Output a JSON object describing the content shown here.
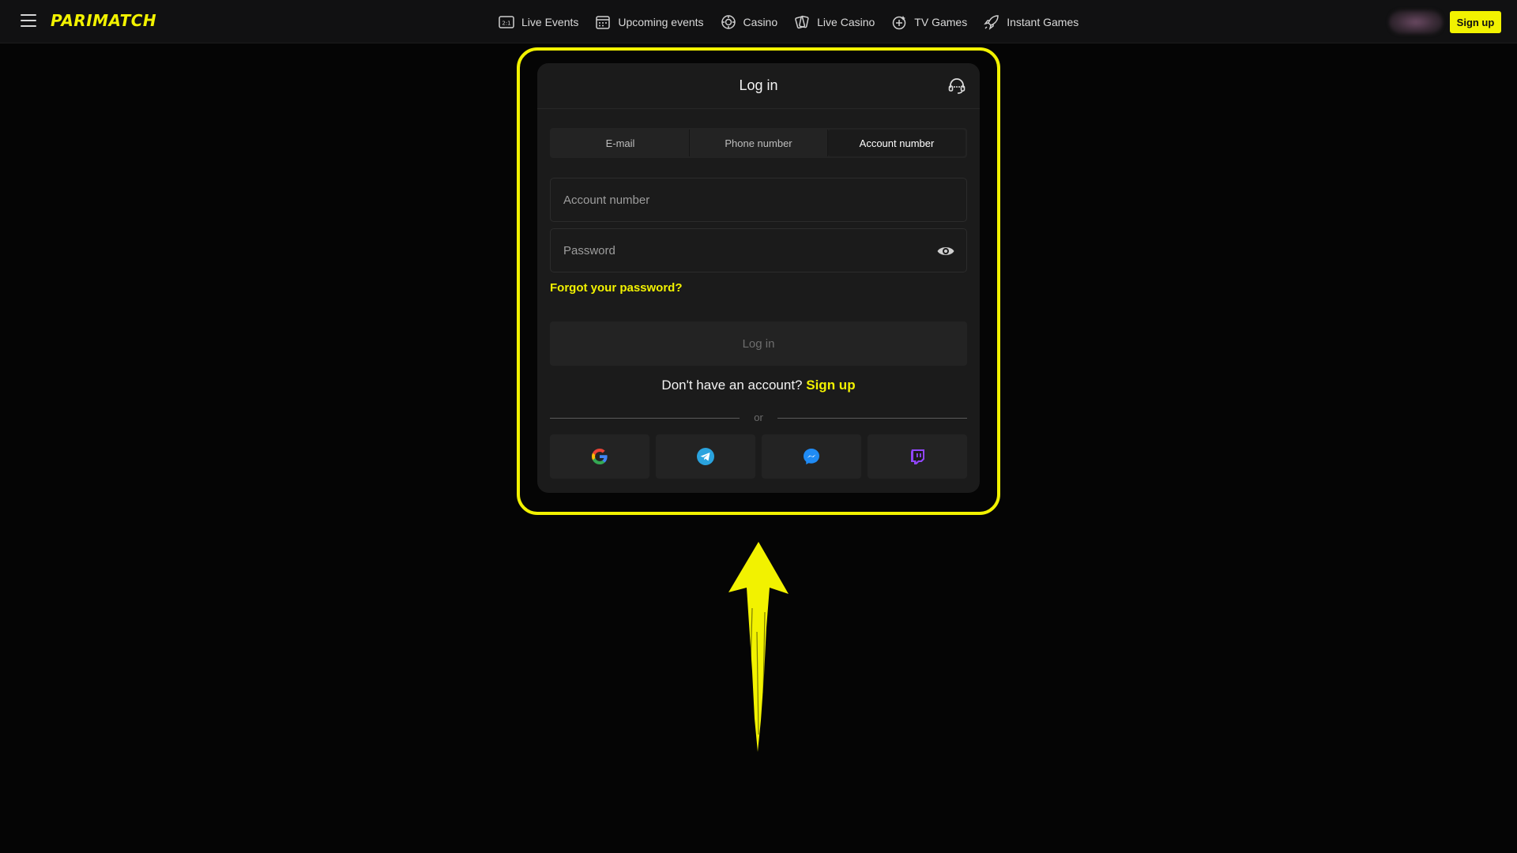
{
  "header": {
    "logo": "PARIMATCH",
    "nav": [
      {
        "label": "Live Events",
        "icon": "live-events-icon"
      },
      {
        "label": "Upcoming events",
        "icon": "calendar-icon"
      },
      {
        "label": "Casino",
        "icon": "casino-chip-icon"
      },
      {
        "label": "Live Casino",
        "icon": "cards-icon"
      },
      {
        "label": "TV Games",
        "icon": "tv-games-icon"
      },
      {
        "label": "Instant Games",
        "icon": "rocket-icon"
      }
    ],
    "signup_label": "Sign up"
  },
  "modal": {
    "title": "Log in",
    "tabs": [
      {
        "label": "E-mail",
        "active": false
      },
      {
        "label": "Phone number",
        "active": false
      },
      {
        "label": "Account number",
        "active": true
      }
    ],
    "account_placeholder": "Account number",
    "password_placeholder": "Password",
    "forgot_label": "Forgot your password?",
    "login_label": "Log in",
    "no_account_text": "Don't have an account?",
    "signup_link": "Sign up",
    "or_label": "or",
    "socials": [
      "google-icon",
      "telegram-icon",
      "messenger-icon",
      "twitch-icon"
    ]
  },
  "colors": {
    "accent": "#f2f200",
    "background": "#050505",
    "panel": "#1b1b1b"
  }
}
